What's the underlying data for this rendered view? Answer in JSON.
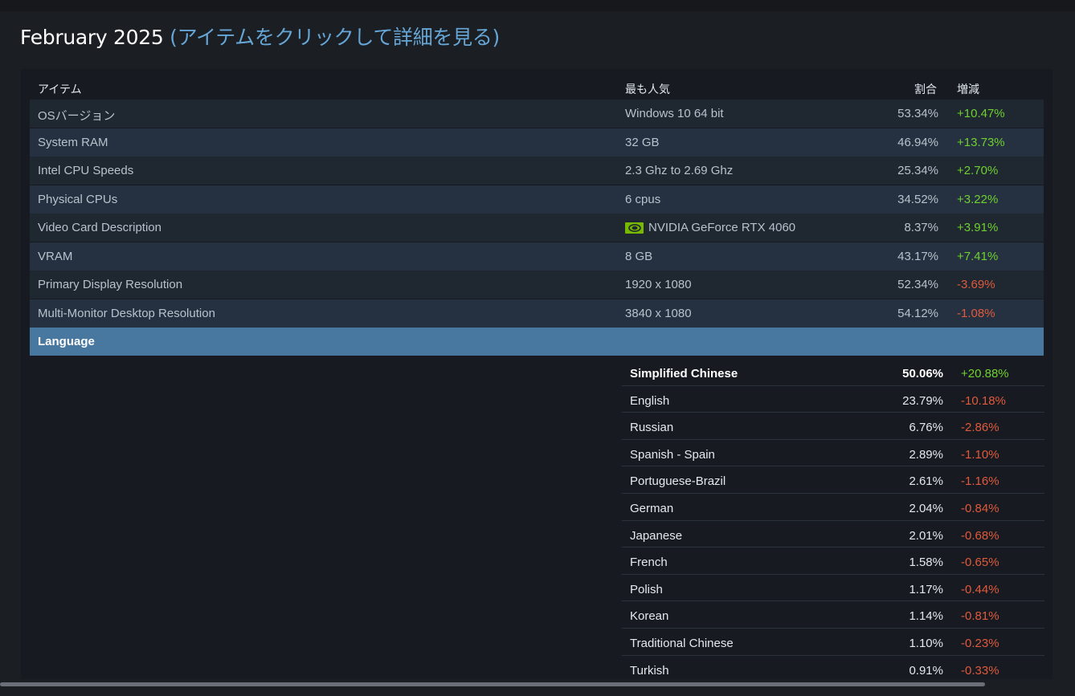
{
  "page": {
    "title": "February 2025",
    "subtitle": "(アイテムをクリックして詳細を見る)"
  },
  "table": {
    "headers": {
      "item": "アイテム",
      "popular": "最も人気",
      "share": "割合",
      "change": "増減"
    },
    "rows": [
      {
        "name": "OSバージョン",
        "popular": "Windows 10 64 bit",
        "share": "53.34%",
        "change": "+10.47%"
      },
      {
        "name": "System RAM",
        "popular": "32 GB",
        "share": "46.94%",
        "change": "+13.73%"
      },
      {
        "name": "Intel CPU Speeds",
        "popular": "2.3 Ghz to 2.69 Ghz",
        "share": "25.34%",
        "change": "+2.70%"
      },
      {
        "name": "Physical CPUs",
        "popular": "6 cpus",
        "share": "34.52%",
        "change": "+3.22%"
      },
      {
        "name": "Video Card Description",
        "popular": "NVIDIA GeForce RTX 4060",
        "share": "8.37%",
        "change": "+3.91%",
        "icon": "nvidia-logo-icon"
      },
      {
        "name": "VRAM",
        "popular": "8 GB",
        "share": "43.17%",
        "change": "+7.41%"
      },
      {
        "name": "Primary Display Resolution",
        "popular": "1920 x 1080",
        "share": "52.34%",
        "change": "-3.69%"
      },
      {
        "name": "Multi-Monitor Desktop Resolution",
        "popular": "3840 x 1080",
        "share": "54.12%",
        "change": "-1.08%"
      }
    ],
    "expanded_row": {
      "name": "Language"
    },
    "languages": [
      {
        "name": "Simplified Chinese",
        "share": "50.06%",
        "change": "+20.88%"
      },
      {
        "name": "English",
        "share": "23.79%",
        "change": "-10.18%"
      },
      {
        "name": "Russian",
        "share": "6.76%",
        "change": "-2.86%"
      },
      {
        "name": "Spanish - Spain",
        "share": "2.89%",
        "change": "-1.10%"
      },
      {
        "name": "Portuguese-Brazil",
        "share": "2.61%",
        "change": "-1.16%"
      },
      {
        "name": "German",
        "share": "2.04%",
        "change": "-0.84%"
      },
      {
        "name": "Japanese",
        "share": "2.01%",
        "change": "-0.68%"
      },
      {
        "name": "French",
        "share": "1.58%",
        "change": "-0.65%"
      },
      {
        "name": "Polish",
        "share": "1.17%",
        "change": "-0.44%"
      },
      {
        "name": "Korean",
        "share": "1.14%",
        "change": "-0.81%"
      },
      {
        "name": "Traditional Chinese",
        "share": "1.10%",
        "change": "-0.23%"
      },
      {
        "name": "Turkish",
        "share": "0.91%",
        "change": "-0.33%"
      }
    ]
  },
  "colors": {
    "positive": "#6fd12e",
    "negative": "#e05a3b",
    "expanded_row": "#4877a0",
    "subtitle": "#66a6d6"
  }
}
